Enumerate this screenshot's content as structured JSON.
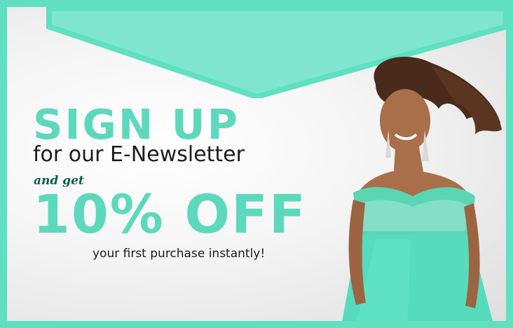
{
  "promo": {
    "headline": "SIGN UP",
    "subheadline": "for our E-Newsletter",
    "connector": "and get",
    "offer": "10% OFF",
    "tagline": "your first purchase instantly!"
  },
  "colors": {
    "accent": "#5ee0c1",
    "flap": "#80e6d0",
    "headline": "#5cd9bc",
    "dark_text": "#1c1c1c",
    "connector_text": "#0b5d54"
  },
  "images": {
    "model_photo": "woman-in-mint-strapless-gown"
  }
}
